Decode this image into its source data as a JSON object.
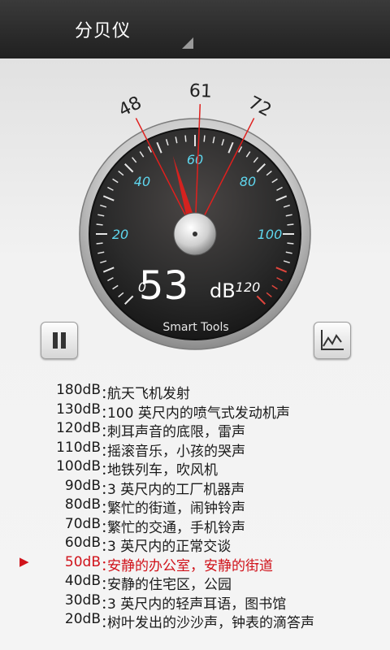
{
  "app": {
    "title": "分贝仪"
  },
  "gauge": {
    "current_value": "53",
    "unit": "dB",
    "brand": "Smart Tools",
    "scale_labels": [
      "0",
      "20",
      "40",
      "60",
      "80",
      "100",
      "120"
    ],
    "scale_min": 0,
    "scale_max": 120,
    "needle_value": 53,
    "markers": [
      {
        "label": "48",
        "value": 48
      },
      {
        "label": "61",
        "value": 61
      },
      {
        "label": "72",
        "value": 72
      }
    ],
    "colors": {
      "accent": "#5fd7ef",
      "marker": "#e0201e",
      "dial": "#2b2b2b"
    }
  },
  "controls": {
    "pause_icon": "pause-icon",
    "chart_icon": "line-chart-icon"
  },
  "reference_list": [
    {
      "db": "180dB",
      "desc": "航天飞机发射",
      "active": false
    },
    {
      "db": "130dB",
      "desc": "100 英尺内的喷气式发动机声",
      "active": false
    },
    {
      "db": "120dB",
      "desc": "刺耳声音的底限，雷声",
      "active": false
    },
    {
      "db": "110dB",
      "desc": "摇滚音乐，小孩的哭声",
      "active": false
    },
    {
      "db": "100dB",
      "desc": "地铁列车，吹风机",
      "active": false
    },
    {
      "db": "90dB",
      "desc": "3 英尺内的工厂机器声",
      "active": false
    },
    {
      "db": "80dB",
      "desc": "繁忙的街道，闹钟铃声",
      "active": false
    },
    {
      "db": "70dB",
      "desc": "繁忙的交通，手机铃声",
      "active": false
    },
    {
      "db": "60dB",
      "desc": "3 英尺内的正常交谈",
      "active": false
    },
    {
      "db": "50dB",
      "desc": "安静的办公室，安静的街道",
      "active": true
    },
    {
      "db": "40dB",
      "desc": "安静的住宅区，公园",
      "active": false
    },
    {
      "db": "30dB",
      "desc": "3 英尺内的轻声耳语，图书馆",
      "active": false
    },
    {
      "db": "20dB",
      "desc": "树叶发出的沙沙声，钟表的滴答声",
      "active": false
    }
  ],
  "active_marker_glyph": "▶",
  "colon": "："
}
